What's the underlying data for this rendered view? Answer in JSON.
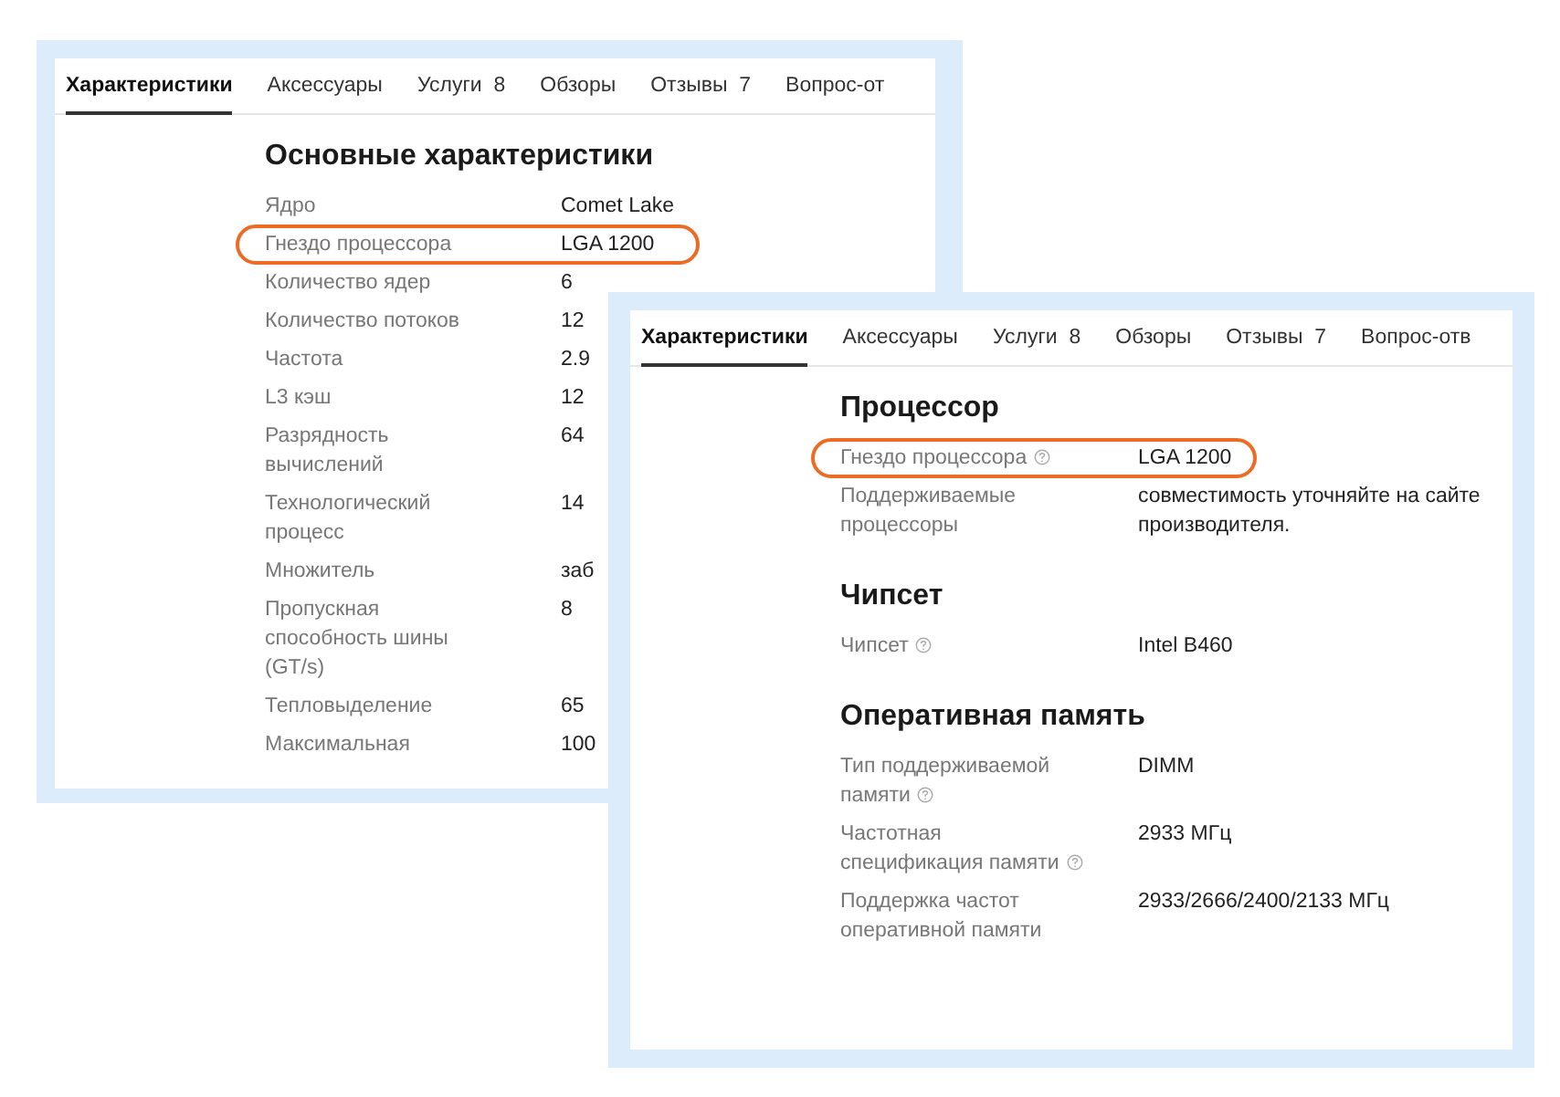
{
  "panels": [
    {
      "tabs": [
        {
          "label": "Характеристики",
          "selected": true
        },
        {
          "label": "Аксессуары",
          "selected": false
        },
        {
          "label": "Услуги",
          "count": "8",
          "selected": false
        },
        {
          "label": "Обзоры",
          "selected": false
        },
        {
          "label": "Отзывы",
          "count": "7",
          "selected": false
        },
        {
          "label": "Вопрос-от",
          "selected": false
        }
      ],
      "sections": [
        {
          "title": "Основные характеристики",
          "rows": [
            {
              "label": "Ядро",
              "value": "Comet Lake",
              "help": false,
              "highlighted": false
            },
            {
              "label": "Гнездо процессора",
              "value": "LGA 1200",
              "help": false,
              "highlighted": true
            },
            {
              "label": "Количество ядер",
              "value": "6",
              "help": false,
              "highlighted": false
            },
            {
              "label": "Количество потоков",
              "value": "12",
              "help": false,
              "highlighted": false
            },
            {
              "label": "Частота",
              "value": "2.9",
              "help": false,
              "highlighted": false
            },
            {
              "label": "L3 кэш",
              "value": "12",
              "help": false,
              "highlighted": false
            },
            {
              "label": "Разрядность вычислений",
              "value": "64",
              "help": false,
              "highlighted": false
            },
            {
              "label": "Технологический процесс",
              "value": "14",
              "help": false,
              "highlighted": false
            },
            {
              "label": "Множитель",
              "value": "заб",
              "help": false,
              "highlighted": false
            },
            {
              "label": "Пропускная способность шины (GT/s)",
              "value": "8",
              "help": false,
              "highlighted": false
            },
            {
              "label": "Тепловыделение",
              "value": "65",
              "help": false,
              "highlighted": false
            },
            {
              "label": "Максимальная",
              "value": "100",
              "help": false,
              "highlighted": false
            }
          ]
        }
      ]
    },
    {
      "tabs": [
        {
          "label": "Характеристики",
          "selected": true
        },
        {
          "label": "Аксессуары",
          "selected": false
        },
        {
          "label": "Услуги",
          "count": "8",
          "selected": false
        },
        {
          "label": "Обзоры",
          "selected": false
        },
        {
          "label": "Отзывы",
          "count": "7",
          "selected": false
        },
        {
          "label": "Вопрос-отв",
          "selected": false
        }
      ],
      "sections": [
        {
          "title": "Процессор",
          "rows": [
            {
              "label": "Гнездо процессора",
              "value": "LGA 1200",
              "help": true,
              "highlighted": true
            },
            {
              "label": "Поддерживаемые процессоры",
              "value": "совместимость уточняйте на сайте производителя.",
              "help": false,
              "highlighted": false
            }
          ]
        },
        {
          "title": "Чипсет",
          "rows": [
            {
              "label": "Чипсет",
              "value": "Intel B460",
              "help": true,
              "highlighted": false
            }
          ]
        },
        {
          "title": "Оперативная память",
          "rows": [
            {
              "label": "Тип поддерживаемой памяти",
              "value": "DIMM",
              "help": true,
              "highlighted": false
            },
            {
              "label": "Частотная спецификация памяти",
              "value": "2933 МГц",
              "help": true,
              "highlighted": false
            },
            {
              "label": "Поддержка частот оперативной памяти",
              "value": "2933/2666/2400/2133 МГц",
              "help": false,
              "highlighted": false
            }
          ]
        }
      ]
    }
  ]
}
